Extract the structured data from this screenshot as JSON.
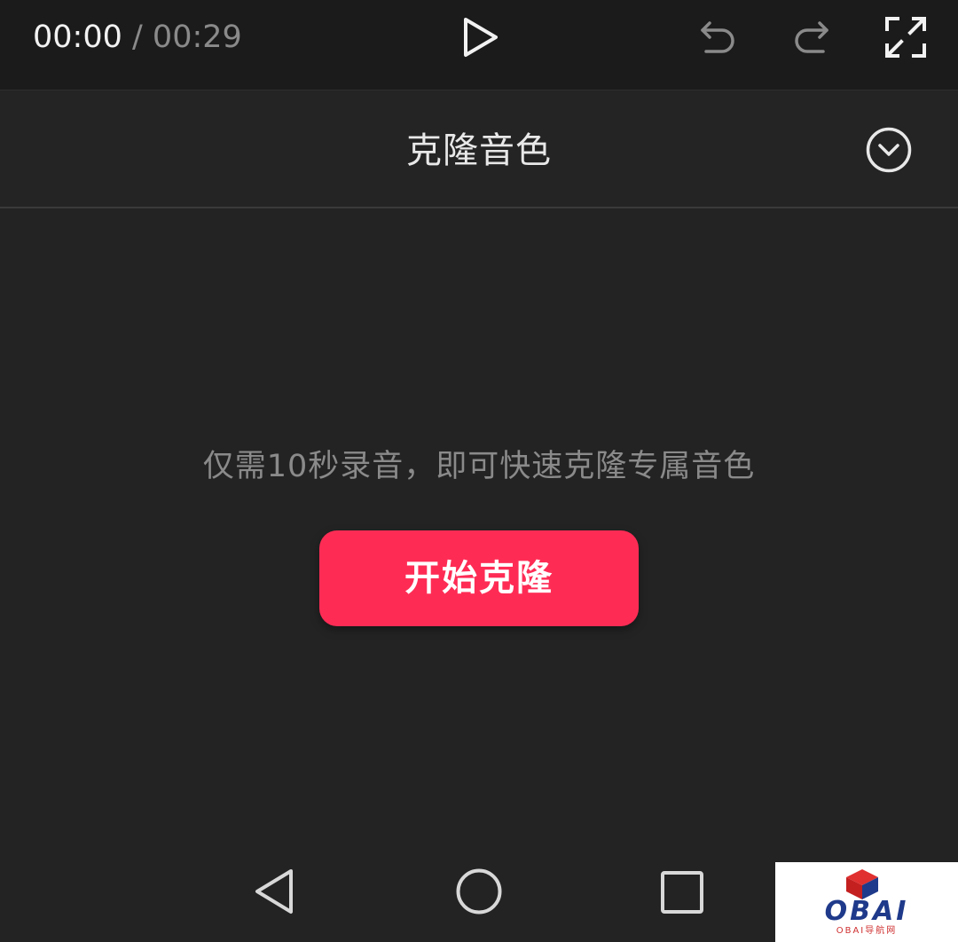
{
  "player": {
    "current_time": "00:00",
    "separator": " / ",
    "total_time": "00:29",
    "icons": {
      "play": "play-icon",
      "undo": "undo-icon",
      "redo": "redo-icon",
      "fullscreen": "fullscreen-icon"
    }
  },
  "panel": {
    "title": "克隆音色",
    "collapse_icon": "chevron-down-circle-icon"
  },
  "body": {
    "hint": "仅需10秒录音，即可快速克隆专属音色",
    "start_button_label": "开始克隆"
  },
  "navbar": {
    "icons": [
      "back-icon",
      "home-icon",
      "recent-apps-icon"
    ]
  },
  "watermark": {
    "brand": "OBAI",
    "subtitle": "OBAI导航网"
  },
  "colors": {
    "accent": "#fe2c55",
    "background": "#232323",
    "topbar": "#1b1b1b",
    "watermark_text": "#1f3a8a",
    "watermark_logo_red": "#e0302f"
  }
}
